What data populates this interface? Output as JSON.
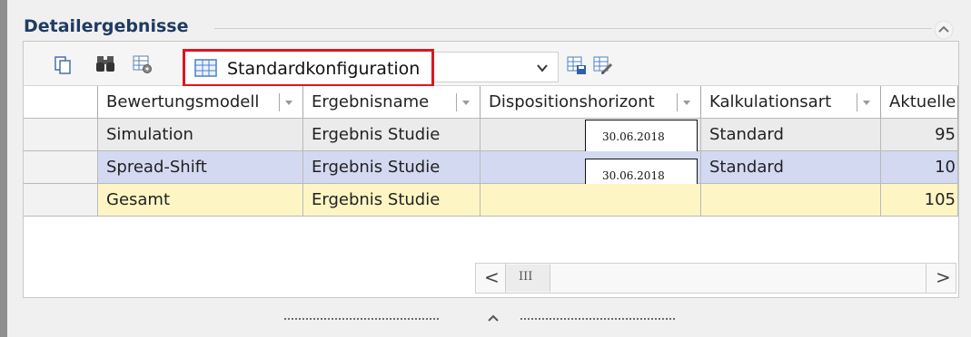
{
  "section": {
    "title": "Detailergebnisse"
  },
  "toolbar": {
    "config_label": "Standardkonfiguration",
    "icons": [
      "copy-icon",
      "binoculars-icon",
      "grid-settings-icon",
      "table-icon",
      "chevron-down-icon",
      "grid-save-icon",
      "grid-edit-icon"
    ]
  },
  "grid": {
    "columns": [
      "Bewertungsmodell",
      "Ergebnisname",
      "Dispositionshorizont",
      "Kalkulationsart",
      "Aktuelle"
    ],
    "rows": [
      {
        "model": "Simulation",
        "name": "Ergebnis Studie",
        "horizon": "30.06.2018",
        "calc": "Standard",
        "current": "95"
      },
      {
        "model": "Spread-Shift",
        "name": "Ergebnis Studie",
        "horizon": "30.06.2018",
        "calc": "Standard",
        "current": "10"
      },
      {
        "model": "Gesamt",
        "name": "Ergebnis Studie",
        "horizon": "",
        "calc": "",
        "current": "105"
      }
    ]
  },
  "scrollbar": {
    "left_arrow": "<",
    "thumb_grip": "III",
    "right_arrow": ">"
  },
  "colors": {
    "title": "#1f3b63",
    "highlight_border": "#e0141e",
    "row_simulation": "#ebebeb",
    "row_spread": "#d4d9f2",
    "row_total": "#fdf6c4"
  }
}
